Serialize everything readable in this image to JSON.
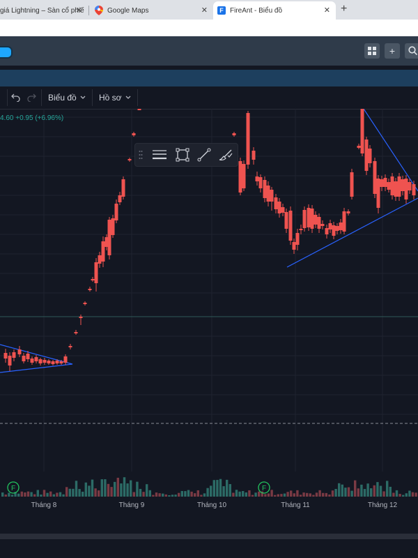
{
  "browser": {
    "tabs": [
      {
        "title": "giá Lightning – Sàn cổ phiế",
        "close": "✕"
      },
      {
        "title": "Google Maps",
        "close": "✕"
      },
      {
        "title": "FireAnt - Biểu đồ",
        "close": "✕",
        "favicon": "F"
      }
    ],
    "new_tab": "+"
  },
  "app": {
    "top_buttons": [
      {
        "icon": "grid-icon"
      },
      {
        "label": "+"
      },
      {
        "icon": "search-icon"
      }
    ]
  },
  "chart_toolbar": {
    "chart_menu": "Biểu đồ",
    "profile_menu": "Hồ sơ",
    "caret": "⌄"
  },
  "price_change": "4.60 +0.95 (+6.96%)",
  "chart_data": {
    "type": "candlestick",
    "x_labels": [
      "Tháng 8",
      "Tháng 9",
      "Tháng 10",
      "Tháng 11",
      "Tháng 12"
    ],
    "event_markers": [
      "F",
      "F"
    ],
    "colors": {
      "up": "#26a69a",
      "down": "#ef5350",
      "trendline": "#2962ff"
    }
  }
}
